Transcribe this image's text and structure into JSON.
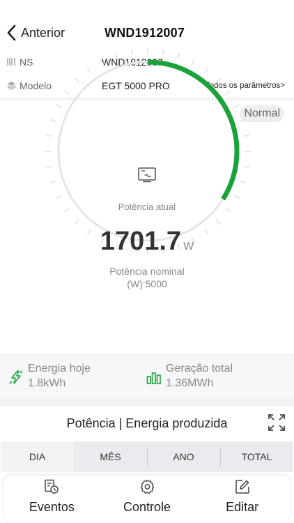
{
  "header": {
    "back_label": "Anterior",
    "title": "WND1912007"
  },
  "info": {
    "ns_label": "NS",
    "ns_value": "WND1912007",
    "model_label": "Modelo",
    "model_value": "EGT 5000 PRO",
    "all_params_link": "Todos os parâmetros>"
  },
  "status_badge": "Normal",
  "gauge": {
    "label": "Potência atual",
    "value": "1701.7",
    "unit": "W",
    "nominal_line1": "Potência nominal",
    "nominal_line2": "(W):5000",
    "fraction": 0.34,
    "color_active": "#1ba23a",
    "color_track": "#e2e5e8"
  },
  "stats": {
    "today_label": "Energia hoje",
    "today_value": "1.8kWh",
    "total_label": "Geração total",
    "total_value": "1.36MWh",
    "accent_color": "#1ba23a"
  },
  "chart": {
    "title": "Potência | Energia produzida",
    "tabs": [
      "DIA",
      "MÊS",
      "ANO",
      "TOTAL"
    ],
    "active_tab": 0
  },
  "toolbar": {
    "events_label": "Eventos",
    "control_label": "Controle",
    "edit_label": "Editar"
  },
  "icons": {
    "back": "chevron-left-icon",
    "ns": "barcode-icon",
    "model": "layers-icon",
    "inverter": "inverter-icon",
    "today": "lightning-icon",
    "total": "bar-chart-icon",
    "expand": "expand-icon",
    "events": "events-icon",
    "control": "gear-icon",
    "edit": "edit-icon"
  }
}
